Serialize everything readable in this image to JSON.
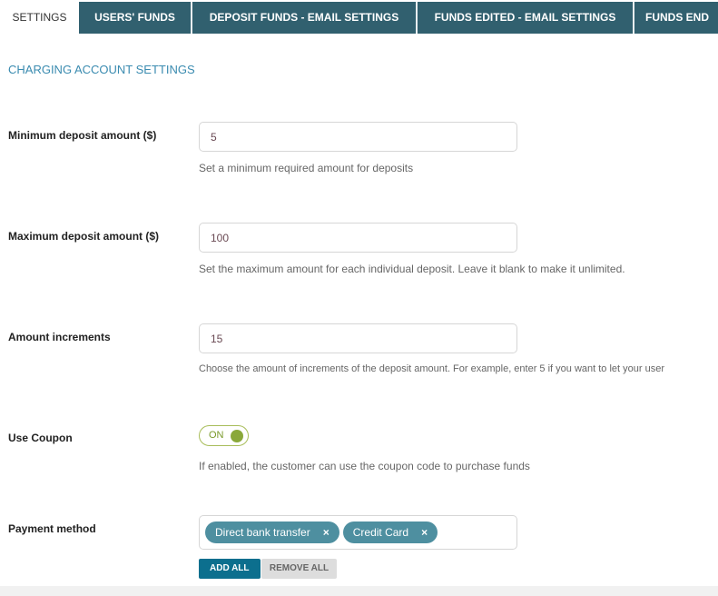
{
  "tabs": [
    {
      "label": "SETTINGS",
      "active": true
    },
    {
      "label": "USERS' FUNDS"
    },
    {
      "label": "DEPOSIT FUNDS - EMAIL SETTINGS"
    },
    {
      "label": "FUNDS EDITED - EMAIL SETTINGS"
    },
    {
      "label": "FUNDS END"
    }
  ],
  "section_title": "CHARGING ACCOUNT SETTINGS",
  "fields": {
    "min": {
      "label": "Minimum deposit amount ($)",
      "value": "5",
      "help": "Set a minimum required amount for deposits"
    },
    "max": {
      "label": "Maximum deposit amount ($)",
      "value": "100",
      "help": "Set the maximum amount for each individual deposit. Leave it blank to make it unlimited."
    },
    "inc": {
      "label": "Amount increments",
      "value": "15",
      "help": "Choose the amount of increments of the deposit amount. For example, enter 5 if you want to let your user"
    },
    "coupon": {
      "label": "Use Coupon",
      "toggle": "ON",
      "help": "If enabled, the customer can use the coupon code to purchase funds"
    },
    "payment": {
      "label": "Payment method",
      "chips": [
        "Direct bank transfer",
        "Credit Card"
      ],
      "remove_icon": "×",
      "add_all": "ADD ALL",
      "remove_all": "REMOVE ALL"
    }
  },
  "colors": {
    "tab": "#31606f",
    "accent": "#3a8bb0",
    "toggle": "#8aa83a",
    "chip": "#4e8fa0",
    "add_button": "#0c6f8e"
  }
}
